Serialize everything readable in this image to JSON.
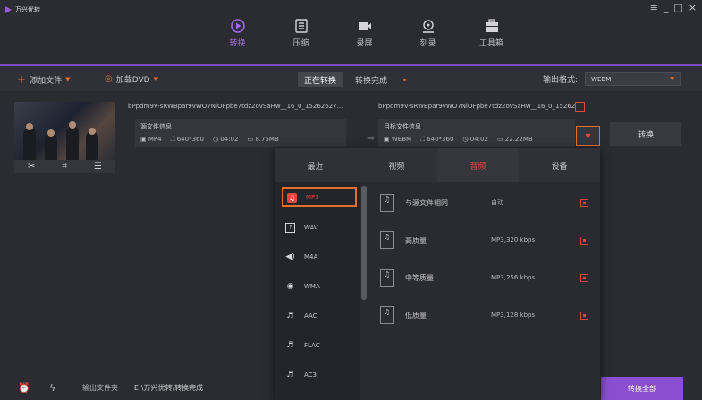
{
  "app": {
    "title": "万兴优转"
  },
  "window_controls": [
    "≡",
    "_",
    "□",
    "×"
  ],
  "nav": [
    {
      "label": "转换",
      "icon": "convert-icon",
      "active": true
    },
    {
      "label": "压缩",
      "icon": "compress-icon",
      "active": false
    },
    {
      "label": "录屏",
      "icon": "record-icon",
      "active": false
    },
    {
      "label": "刻录",
      "icon": "burn-icon",
      "active": false
    },
    {
      "label": "工具箱",
      "icon": "toolbox-icon",
      "active": false
    }
  ],
  "toolbar": {
    "add_file": "添加文件",
    "load_dvd": "加载DVD",
    "tab_converting": "正在转换",
    "tab_done": "转换完成",
    "tab_done_dot": "•",
    "output_format_label": "输出格式:",
    "output_format_value": "WEBM"
  },
  "file": {
    "source_name": "bPpdm9V-sRWBpar9vWO7NlOFpbe7tdz2ovSaHw__16_0_15262627...",
    "target_name": "bPpdm9V-sRWBpar9vWO7NlOFpbe7tdz2ovSaHw__16_0_15262...",
    "source_info_title": "源文件信息",
    "source_format": "MP4",
    "source_resolution": "640*360",
    "source_duration": "04:02",
    "source_size": "8.75MB",
    "target_info_title": "目标文件信息",
    "target_format": "WEBM",
    "target_resolution": "640*360",
    "target_duration": "04:02",
    "target_size": "22.22MB",
    "convert_label": "转换"
  },
  "popup": {
    "tabs": [
      {
        "label": "最近",
        "active": false
      },
      {
        "label": "视频",
        "active": false
      },
      {
        "label": "音频",
        "active": true
      },
      {
        "label": "设备",
        "active": false
      }
    ],
    "formats": [
      {
        "label": "MP3",
        "icon": "music-note-icon",
        "selected": true
      },
      {
        "label": "WAV",
        "icon": "music-note-icon",
        "selected": false
      },
      {
        "label": "M4A",
        "icon": "speaker-icon",
        "selected": false
      },
      {
        "label": "WMA",
        "icon": "disc-icon",
        "selected": false
      },
      {
        "label": "AAC",
        "icon": "waveform-icon",
        "selected": false
      },
      {
        "label": "FLAC",
        "icon": "waveform-icon",
        "selected": false
      },
      {
        "label": "AC3",
        "icon": "waveform-icon",
        "selected": false
      }
    ],
    "qualities": [
      {
        "name": "与源文件相同",
        "rate": "自动"
      },
      {
        "name": "高质量",
        "rate": "MP3,320 kbps"
      },
      {
        "name": "中等质量",
        "rate": "MP3,256 kbps"
      },
      {
        "name": "低质量",
        "rate": "MP3,128 kbps"
      }
    ]
  },
  "bottom": {
    "output_folder_label": "输出文件夹",
    "output_path": "E:\\万兴优转\\转换完成",
    "convert_all": "转换全部"
  },
  "colors": {
    "accent_purple": "#8a4fd0",
    "accent_orange": "#e4702e",
    "accent_red": "#e0473f"
  }
}
